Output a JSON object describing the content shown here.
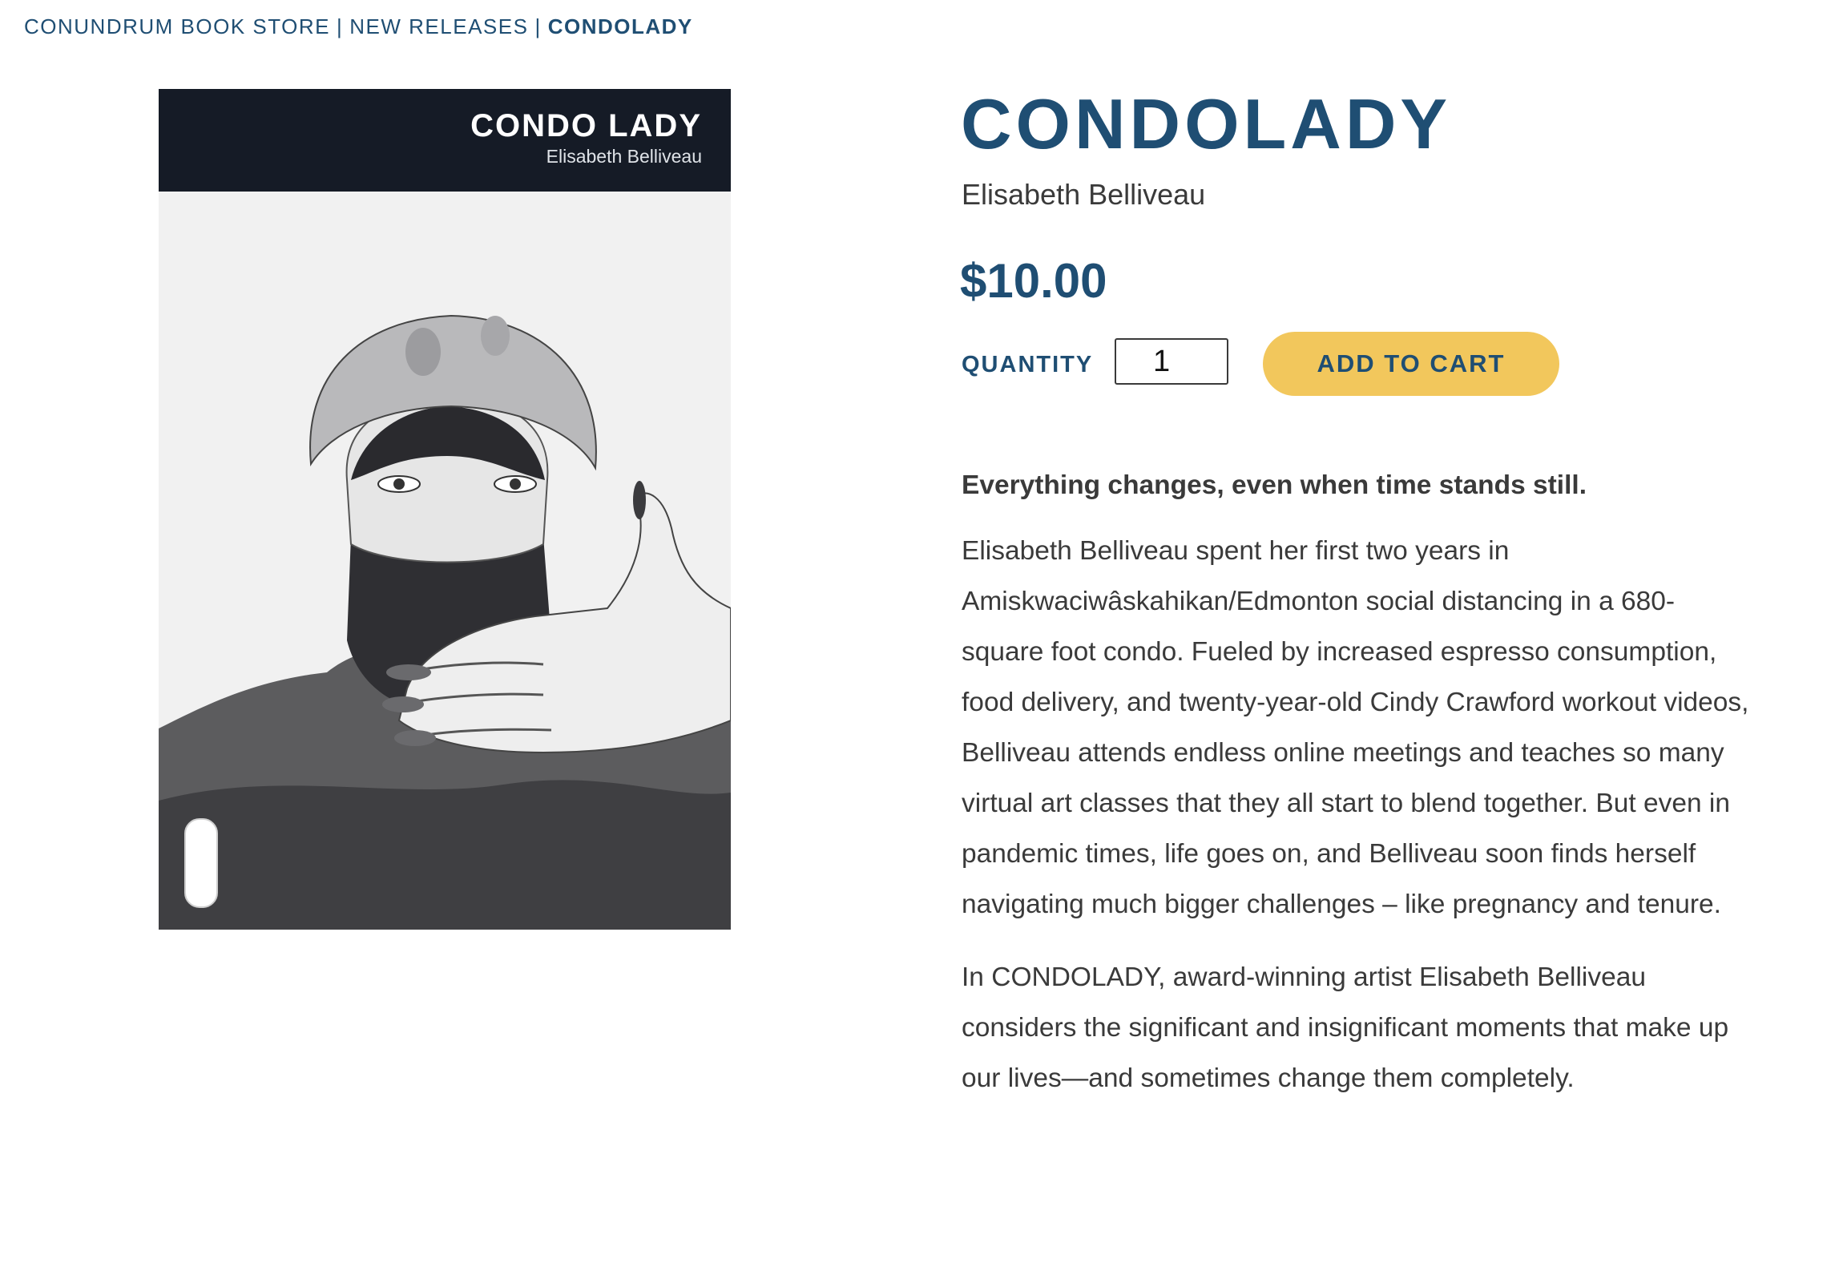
{
  "breadcrumb": {
    "items": [
      "CONUNDRUM BOOK STORE",
      "NEW RELEASES",
      "CONDOLADY"
    ],
    "separator": "|"
  },
  "book_cover": {
    "title": "CONDO LADY",
    "author": "Elisabeth Belliveau"
  },
  "product": {
    "title": "CONDOLADY",
    "author": "Elisabeth Belliveau",
    "price": "$10.00",
    "quantity_label": "QUANTITY",
    "quantity_value": "1",
    "add_to_cart_label": "ADD TO CART"
  },
  "description": {
    "tagline": "Everything changes, even when time stands still.",
    "paragraph_1": "Elisabeth Belliveau spent her first two years in Amiskwaciwâskahikan/Edmonton social distancing in a 680-square foot condo. Fueled by increased espresso consumption, food delivery, and twenty-year-old Cindy Crawford workout videos, Belliveau attends endless online meetings and teaches so many virtual art classes that they all start to blend together. But even in pandemic times, life goes on, and Belliveau soon finds herself navigating much bigger challenges – like pregnancy and tenure.",
    "paragraph_2": "In CONDOLADY, award-winning artist Elisabeth Belliveau considers the significant and insignificant moments that make up our lives—and sometimes change them completely."
  },
  "colors": {
    "brand": "#1f4e73",
    "button": "#f2c75c",
    "text": "#3a3a3a"
  }
}
